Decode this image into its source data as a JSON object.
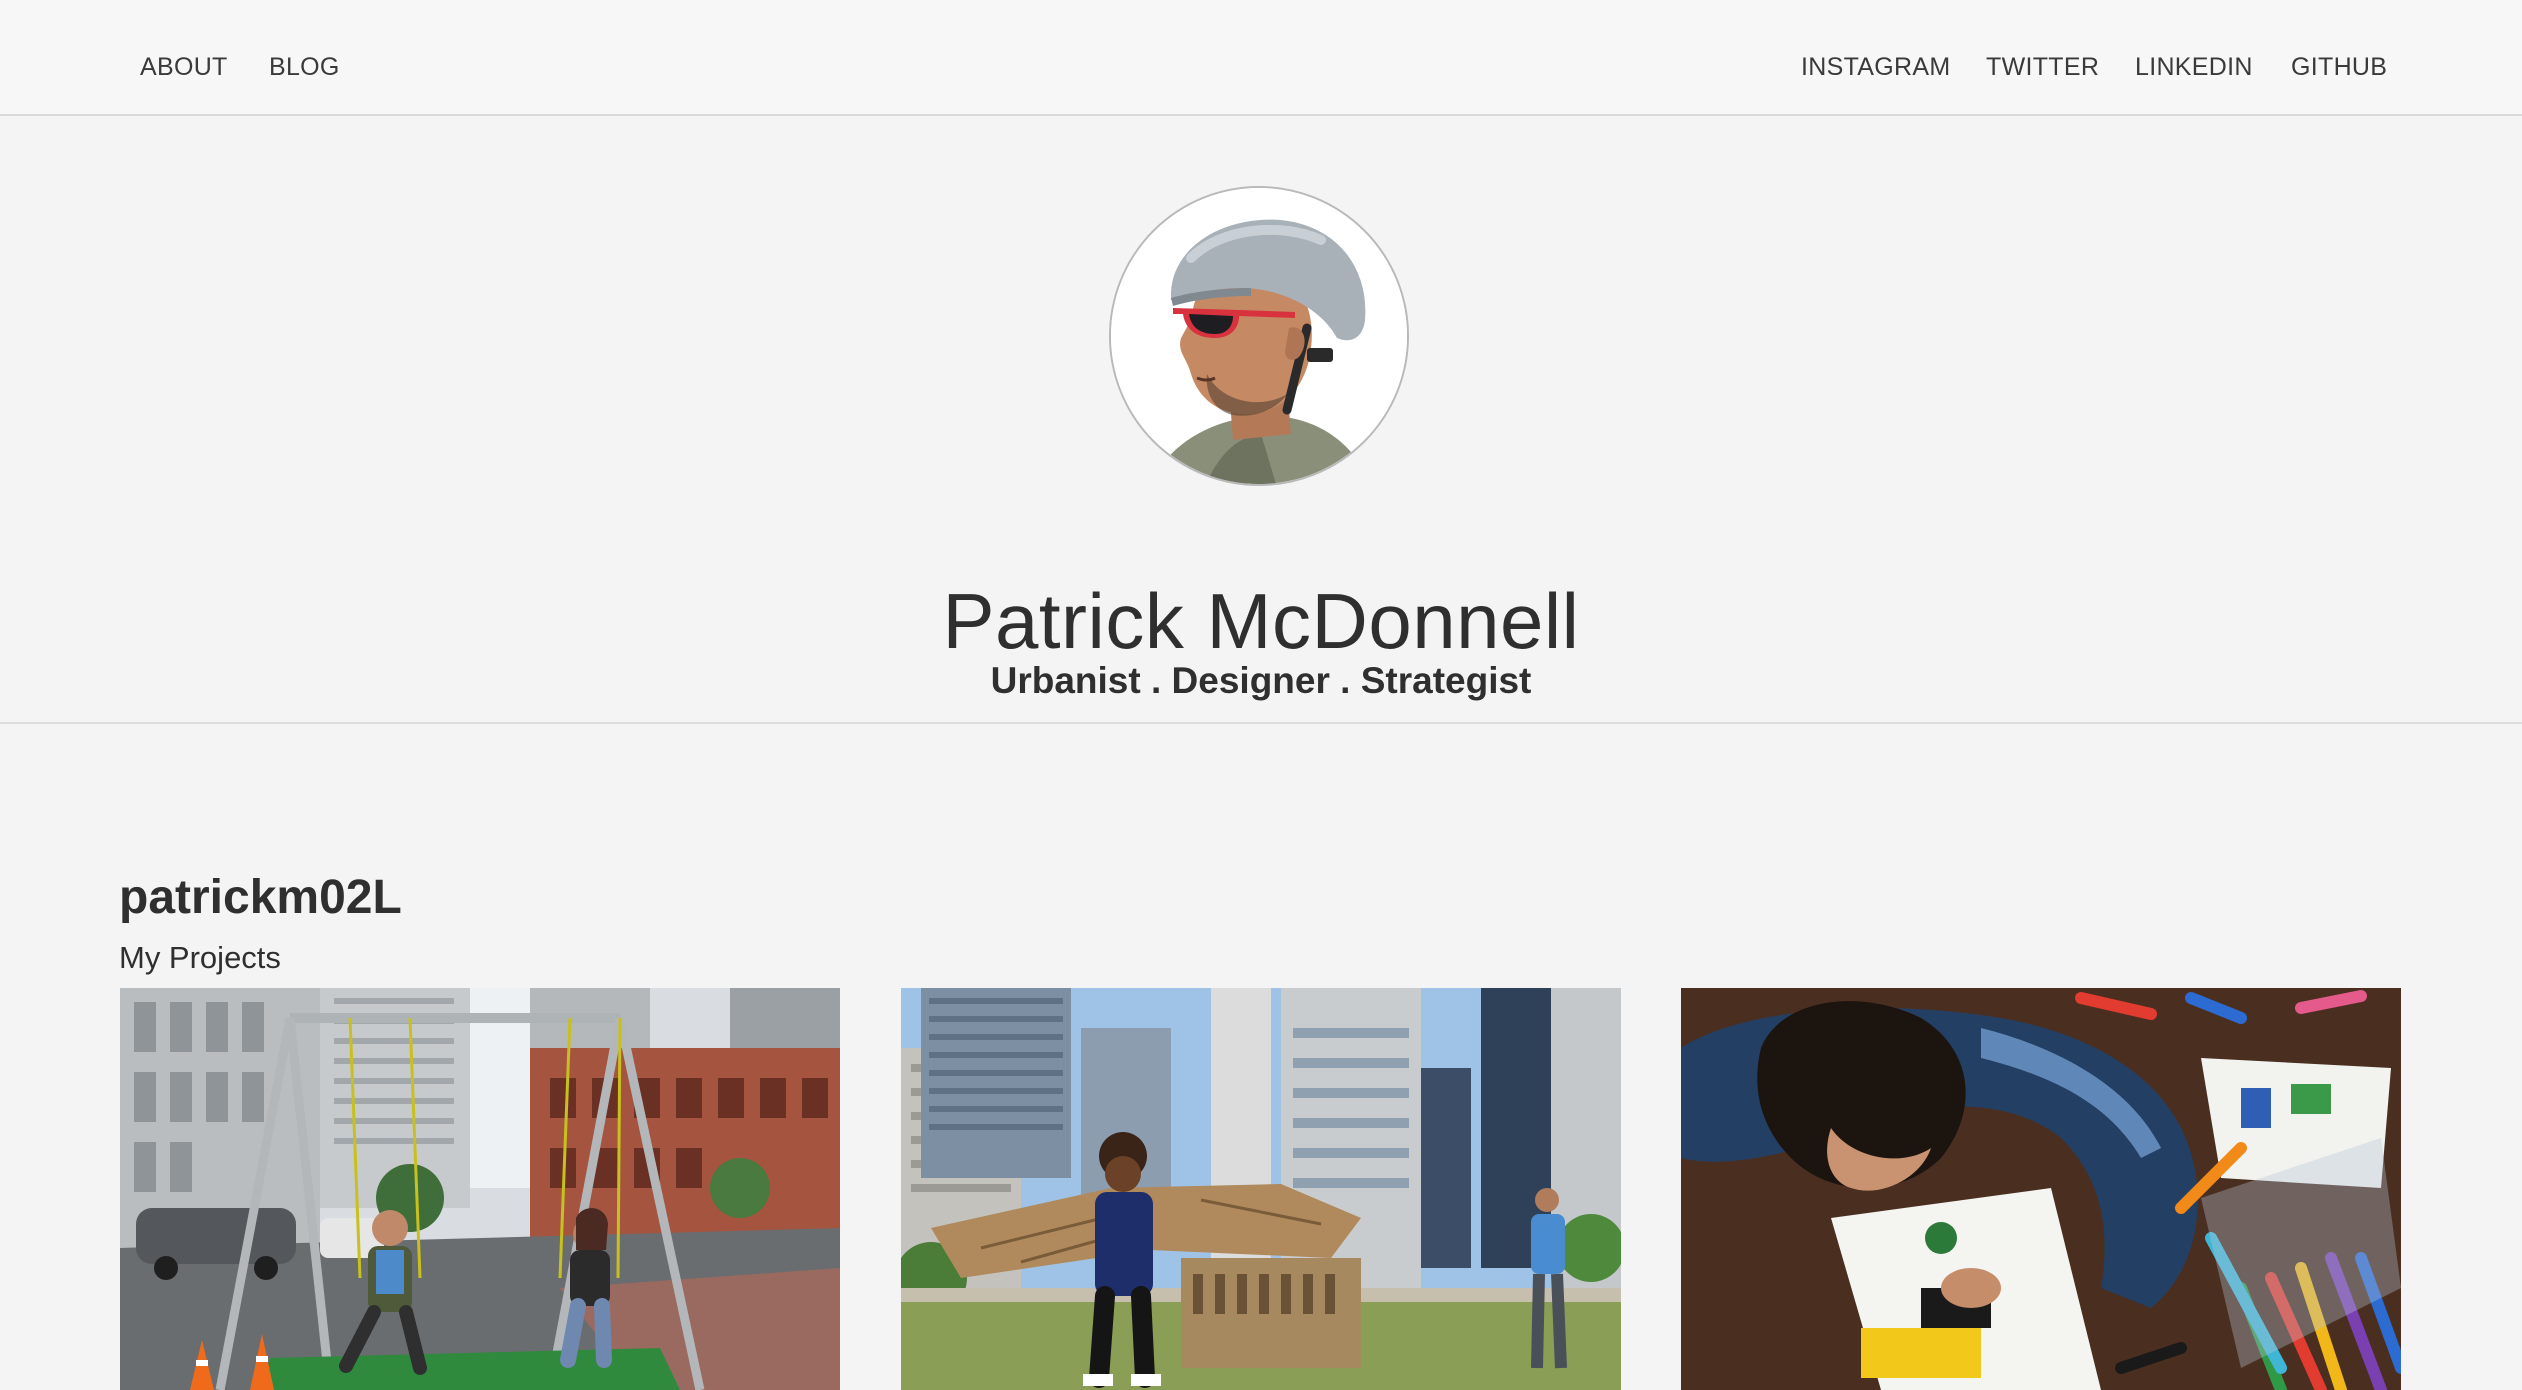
{
  "nav": {
    "left": [
      {
        "label": "ABOUT"
      },
      {
        "label": "BLOG"
      }
    ],
    "right": [
      {
        "label": "INSTAGRAM"
      },
      {
        "label": "TWITTER"
      },
      {
        "label": "LINKEDIN"
      },
      {
        "label": "GITHUB"
      }
    ]
  },
  "hero": {
    "name": "Patrick McDonnell",
    "tagline": "Urbanist . Designer . Strategist"
  },
  "projects": {
    "username": "patrickm02L",
    "heading": "My Projects",
    "cards": [
      {
        "image": "photo-swing-set-city-street"
      },
      {
        "image": "photo-child-cardboard-wings-plaza"
      },
      {
        "image": "photo-child-drawing-markers"
      }
    ]
  },
  "colors": {
    "background": "#f4f4f4",
    "text": "#2f2f2f",
    "divider": "#d9d9d9"
  }
}
